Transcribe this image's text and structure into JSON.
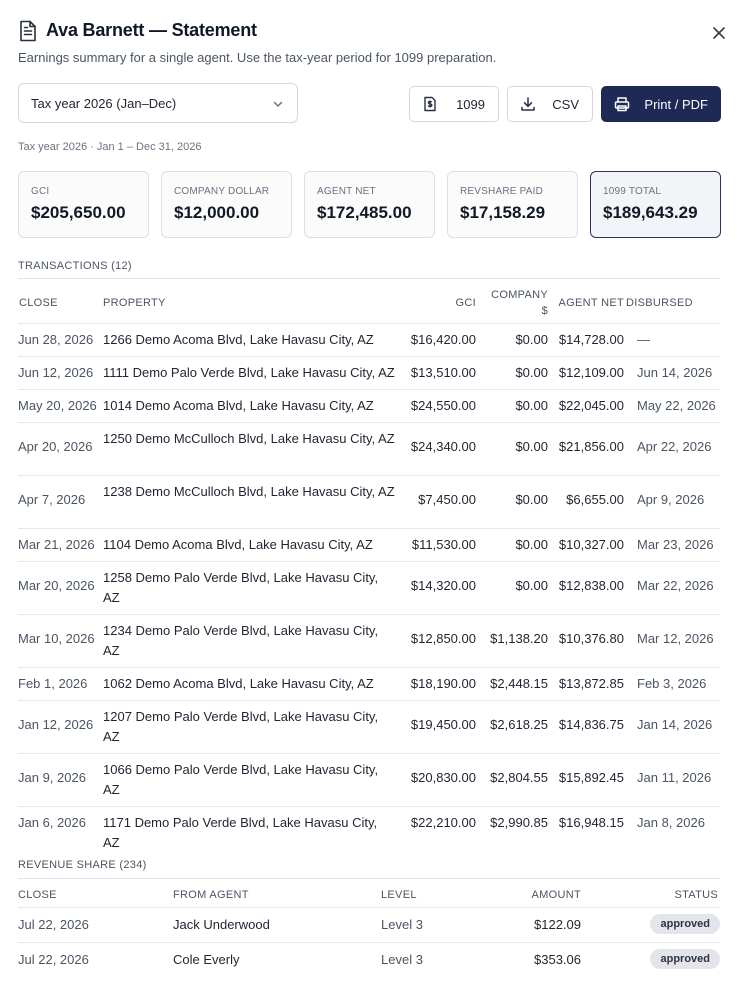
{
  "header": {
    "title": "Ava Barnett — Statement",
    "subtitle": "Earnings summary for a single agent. Use the tax-year period for 1099 preparation."
  },
  "toolbar": {
    "period_value": "Tax year 2026 (Jan–Dec)",
    "btn_1099": "1099",
    "btn_csv": "CSV",
    "btn_print": "Print / PDF"
  },
  "period_note": "Tax year 2026 · Jan 1 – Dec 31, 2026",
  "cards": [
    {
      "label": "GCI",
      "value": "$205,650.00"
    },
    {
      "label": "COMPANY DOLLAR",
      "value": "$12,000.00"
    },
    {
      "label": "AGENT NET",
      "value": "$172,485.00"
    },
    {
      "label": "REVSHARE PAID",
      "value": "$17,158.29"
    },
    {
      "label": "1099 TOTAL",
      "value": "$189,643.29"
    }
  ],
  "transactions": {
    "title": "TRANSACTIONS (12)",
    "headers": {
      "close": "CLOSE",
      "property": "PROPERTY",
      "gci": "GCI",
      "company_1": "COMPANY",
      "company_2": "$",
      "net": "AGENT NET",
      "disbursed": "DISBURSED"
    },
    "rows": [
      {
        "close": "Jun 28, 2026",
        "property": "1266 Demo Acoma Blvd, Lake Havasu City, AZ",
        "gci": "$16,420.00",
        "company": "$0.00",
        "net": "$14,728.00",
        "disbursed": "—"
      },
      {
        "close": "Jun 12, 2026",
        "property": "1111 Demo Palo Verde Blvd, Lake Havasu City, AZ",
        "gci": "$13,510.00",
        "company": "$0.00",
        "net": "$12,109.00",
        "disbursed": "Jun 14, 2026"
      },
      {
        "close": "May 20, 2026",
        "property": "1014 Demo Acoma Blvd, Lake Havasu City, AZ",
        "gci": "$24,550.00",
        "company": "$0.00",
        "net": "$22,045.00",
        "disbursed": "May 22, 2026"
      },
      {
        "close": "Apr 20, 2026",
        "property": "1250 Demo McCulloch Blvd, Lake Havasu City, AZ",
        "gci": "$24,340.00",
        "company": "$0.00",
        "net": "$21,856.00",
        "disbursed": "Apr 22, 2026"
      },
      {
        "close": "Apr 7, 2026",
        "property": "1238 Demo McCulloch Blvd, Lake Havasu City, AZ",
        "gci": "$7,450.00",
        "company": "$0.00",
        "net": "$6,655.00",
        "disbursed": "Apr 9, 2026"
      },
      {
        "close": "Mar 21, 2026",
        "property": "1104 Demo Acoma Blvd, Lake Havasu City, AZ",
        "gci": "$11,530.00",
        "company": "$0.00",
        "net": "$10,327.00",
        "disbursed": "Mar 23, 2026"
      },
      {
        "close": "Mar 20, 2026",
        "property": "1258 Demo Palo Verde Blvd, Lake Havasu City, AZ",
        "gci": "$14,320.00",
        "company": "$0.00",
        "net": "$12,838.00",
        "disbursed": "Mar 22, 2026"
      },
      {
        "close": "Mar 10, 2026",
        "property": "1234 Demo Palo Verde Blvd, Lake Havasu City, AZ",
        "gci": "$12,850.00",
        "company": "$1,138.20",
        "net": "$10,376.80",
        "disbursed": "Mar 12, 2026"
      },
      {
        "close": "Feb 1, 2026",
        "property": "1062 Demo Acoma Blvd, Lake Havasu City, AZ",
        "gci": "$18,190.00",
        "company": "$2,448.15",
        "net": "$13,872.85",
        "disbursed": "Feb 3, 2026"
      },
      {
        "close": "Jan 12, 2026",
        "property": "1207 Demo Palo Verde Blvd, Lake Havasu City, AZ",
        "gci": "$19,450.00",
        "company": "$2,618.25",
        "net": "$14,836.75",
        "disbursed": "Jan 14, 2026"
      },
      {
        "close": "Jan 9, 2026",
        "property": "1066 Demo Palo Verde Blvd, Lake Havasu City, AZ",
        "gci": "$20,830.00",
        "company": "$2,804.55",
        "net": "$15,892.45",
        "disbursed": "Jan 11, 2026"
      },
      {
        "close": "Jan 6, 2026",
        "property": "1171 Demo Palo Verde Blvd, Lake Havasu City, AZ",
        "gci": "$22,210.00",
        "company": "$2,990.85",
        "net": "$16,948.15",
        "disbursed": "Jan 8, 2026"
      }
    ]
  },
  "revshare": {
    "title": "REVENUE SHARE (234)",
    "headers": {
      "close": "CLOSE",
      "from_agent": "FROM AGENT",
      "level": "LEVEL",
      "amount": "AMOUNT",
      "status": "STATUS"
    },
    "rows": [
      {
        "close": "Jul 22, 2026",
        "from_agent": "Jack Underwood",
        "level": "Level 3",
        "amount": "$122.09",
        "status": "approved"
      },
      {
        "close": "Jul 22, 2026",
        "from_agent": "Cole Everly",
        "level": "Level 3",
        "amount": "$353.06",
        "status": "approved"
      }
    ]
  }
}
